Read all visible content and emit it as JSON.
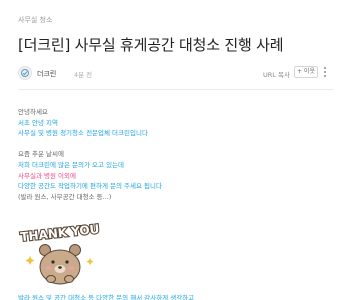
{
  "category": "사무실 청소",
  "title": "[더크린] 사무실 휴게공간 대청소 진행 사례",
  "author": {
    "name": "더크린",
    "time": "4분 전"
  },
  "actions": {
    "url_copy": "URL 복사",
    "neighbor": "+ 이웃"
  },
  "body": {
    "greeting": "안녕하세요",
    "p1": [
      "서초 안녕 지역",
      "사무실 및 병원 정기청소 전문업체 더크린입니다"
    ],
    "p2": [
      "요즘 추운 날씨에",
      "저희 더크린에 많은 문의가 오고 있는데",
      "사무실과 병원 이외에",
      "다양한 공간도 작업하기에 편하게 문의 주세요 됩니다",
      "(발라 원스, 사무공간 대청소 등...)"
    ],
    "bottom": "발라 원스 및 공간 대청소 등 다양한 문의 해서 감사하게 생각하고"
  },
  "sticker": {
    "text": "THANK YOU"
  },
  "colors": {
    "blue": "#1da3e2",
    "pink": "#f0478a",
    "gray": "#666666"
  }
}
